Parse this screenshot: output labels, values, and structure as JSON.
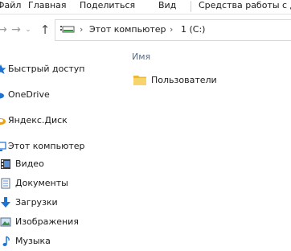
{
  "ribbon": {
    "tabs": [
      "Файл",
      "Главная",
      "Поделиться",
      "Вид",
      "Средства работы с ди"
    ]
  },
  "address": {
    "crumbs": [
      "Этот компьютер",
      "1 (C:)"
    ]
  },
  "sidebar": {
    "items": [
      {
        "label": "Быстрый доступ",
        "icon": "star-icon"
      },
      {
        "label": "OneDrive",
        "icon": "cloud-icon"
      },
      {
        "label": "Яндекс.Диск",
        "icon": "yandex-disk-icon"
      },
      {
        "label": "Этот компьютер",
        "icon": "computer-icon"
      },
      {
        "label": "Видео",
        "icon": "video-icon"
      },
      {
        "label": "Документы",
        "icon": "documents-icon"
      },
      {
        "label": "Загрузки",
        "icon": "download-icon"
      },
      {
        "label": "Изображения",
        "icon": "pictures-icon"
      },
      {
        "label": "Музыка",
        "icon": "music-icon"
      }
    ]
  },
  "content": {
    "column_header": "Имя",
    "rows": [
      {
        "name": "Пользователи",
        "icon": "folder-icon"
      }
    ]
  },
  "colors": {
    "accent": "#1e73d2",
    "folder": "#f3c94b",
    "header_text": "#5a6d86"
  }
}
